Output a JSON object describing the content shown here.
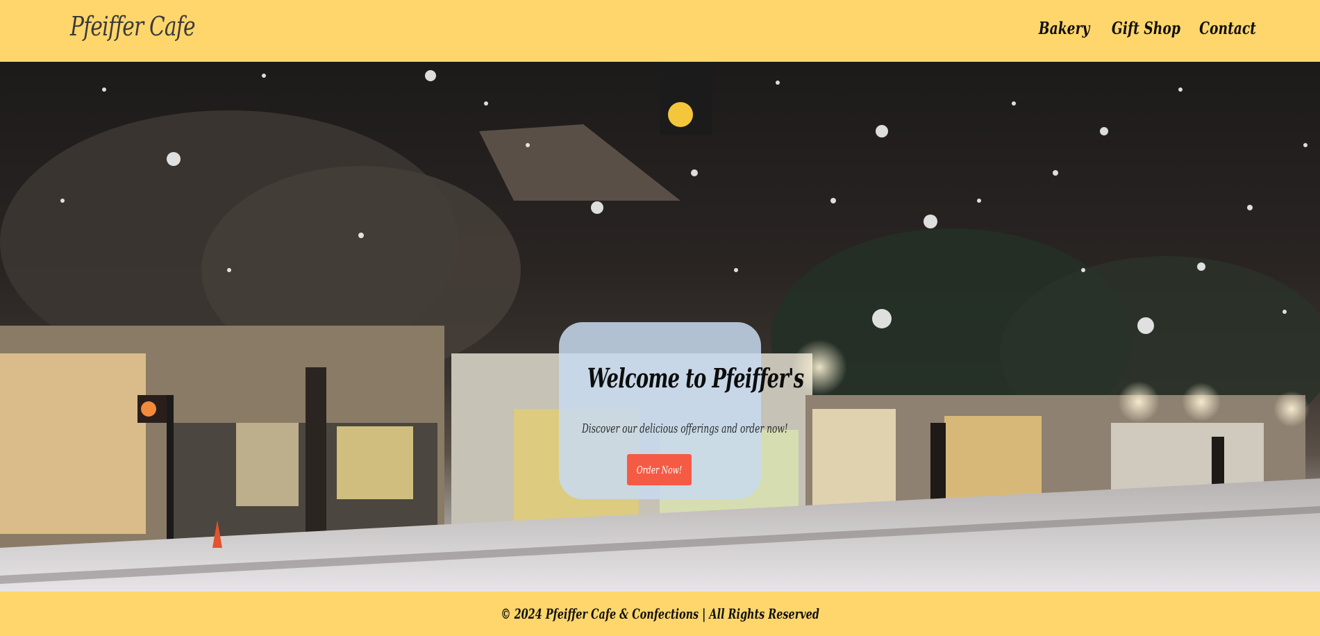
{
  "navbar": {
    "logo": "Pfeiffer Cafe",
    "links": [
      {
        "label": "Bakery"
      },
      {
        "label": "Gift Shop"
      },
      {
        "label": "Contact"
      }
    ]
  },
  "hero": {
    "title": "Welcome to Pfeiffer's",
    "subtitle": "Discover our delicious offerings and order now!",
    "button_label": "Order Now!"
  },
  "footer": {
    "text": "© 2024 Pfeiffer Cafe & Confections | All Rights Reserved"
  },
  "colors": {
    "navbar_bg": "#FFD66B",
    "button_bg": "#F55A45",
    "card_bg": "#C8DAF0"
  }
}
